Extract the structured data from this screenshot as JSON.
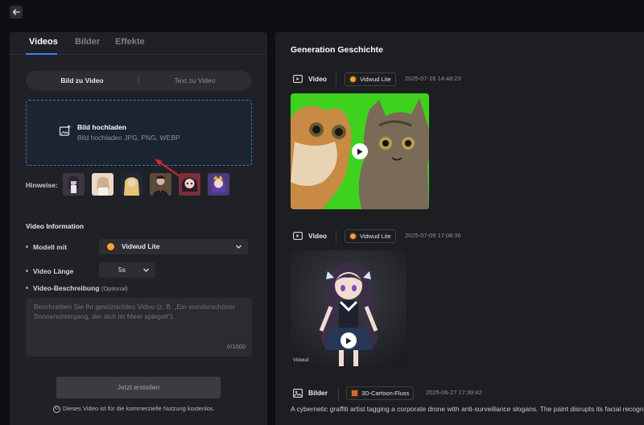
{
  "left": {
    "tabs": [
      "Videos",
      "Bilder",
      "Effekte"
    ],
    "segment": [
      "Bild zu Video",
      "Text zu Video"
    ],
    "upload": {
      "title": "Bild hochladen",
      "subtitle": "Bild hochladen JPG, PNG, WEBP"
    },
    "hints_label": "Hinweise:",
    "video_info": {
      "title": "Video Information",
      "model_label": "Modell mit",
      "model_value": "Vidwud Lite",
      "length_label": "Video Länge",
      "length_value": "5s",
      "desc_label": "Video-Beschreibung",
      "desc_optional": "(Optional)",
      "desc_placeholder": "Beschreiben Sie Ihr gewünschtes Video (z. B. „Ein wunderschöner Sonnenuntergang, der sich im Meer spiegelt\").",
      "counter": "0/1000"
    },
    "generate_button": "Jetzt erstellen",
    "note": "Dieses Video ist für die kommerzielle Nutzung kostenlos.",
    "note_symbol": "©"
  },
  "history": {
    "title": "Generation Geschichte",
    "entries": [
      {
        "type": "Video",
        "model": "Vidwud Lite",
        "date": "2025-07-16 14:48:23"
      },
      {
        "type": "Video",
        "model": "Vidwud Lite",
        "date": "2025-07-09 17:08:36",
        "watermark": "Vidwud"
      },
      {
        "type": "Bilder",
        "model": "3D-Cartoon-Fluss",
        "date": "2025-06-27 17:39:42"
      }
    ],
    "description": "A cybernetic graffiti artist tagging a corporate drone with anti-surveillance slogans. The paint disrupts its facial recogn"
  },
  "colors": {
    "accent": "#3b82f6",
    "brand_badge": "#f2a23a",
    "upload_border": "#3f72b8",
    "arrow_red": "#d62828"
  }
}
